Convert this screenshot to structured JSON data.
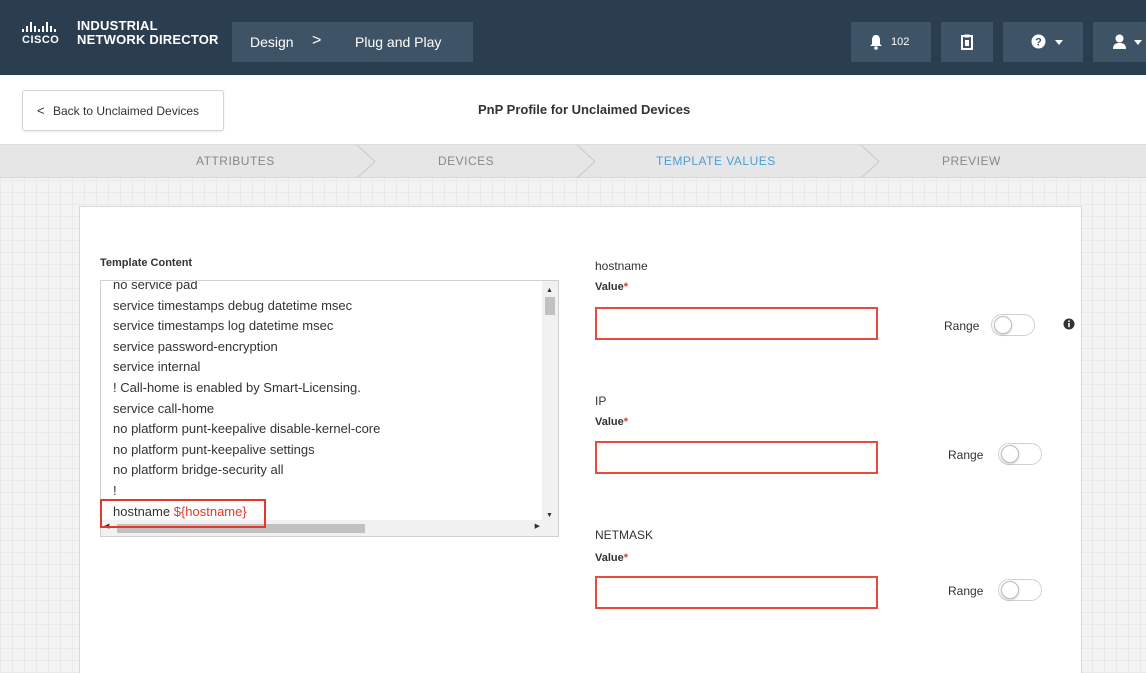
{
  "header": {
    "brand_prefix": "CISCO",
    "product_line1": "INDUSTRIAL",
    "product_line2": "NETWORK DIRECTOR",
    "breadcrumb": [
      {
        "label": "Design",
        "separator": ">"
      },
      {
        "label": "Plug and Play"
      }
    ],
    "notification_count": "102",
    "icons": [
      "bell-icon",
      "clipboard-icon",
      "help-icon",
      "user-icon"
    ]
  },
  "subheader": {
    "back_label": "Back to Unclaimed Devices",
    "back_chevron": "<",
    "page_title": "PnP Profile for Unclaimed Devices"
  },
  "steps": [
    {
      "label": "ATTRIBUTES",
      "active": false
    },
    {
      "label": "DEVICES",
      "active": false
    },
    {
      "label": "TEMPLATE VALUES",
      "active": true
    },
    {
      "label": "PREVIEW",
      "active": false
    }
  ],
  "template": {
    "label": "Template Content",
    "lines": [
      "no service pad",
      "service timestamps debug datetime msec",
      "service timestamps log datetime msec",
      "service password-encryption",
      "service internal",
      "! Call-home is enabled by Smart-Licensing.",
      "service call-home",
      "no platform punt-keepalive disable-kernel-core",
      "no platform punt-keepalive settings",
      "no platform bridge-security all",
      "!"
    ],
    "highlight_prefix": "hostname ",
    "highlight_var": "${hostname}"
  },
  "fields": [
    {
      "name": "hostname",
      "value_label": "Value",
      "required_mark": "*",
      "value": "",
      "range_label": "Range",
      "range_on": false
    },
    {
      "name": "IP",
      "value_label": "Value",
      "required_mark": "*",
      "value": "",
      "range_label": "Range",
      "range_on": false
    },
    {
      "name": "NETMASK",
      "value_label": "Value",
      "required_mark": "*",
      "value": "",
      "range_label": "Range",
      "range_on": false
    }
  ],
  "colors": {
    "header_bg": "#2b3e50",
    "active_step": "#4a9fd8",
    "error_red": "#e0392b"
  }
}
